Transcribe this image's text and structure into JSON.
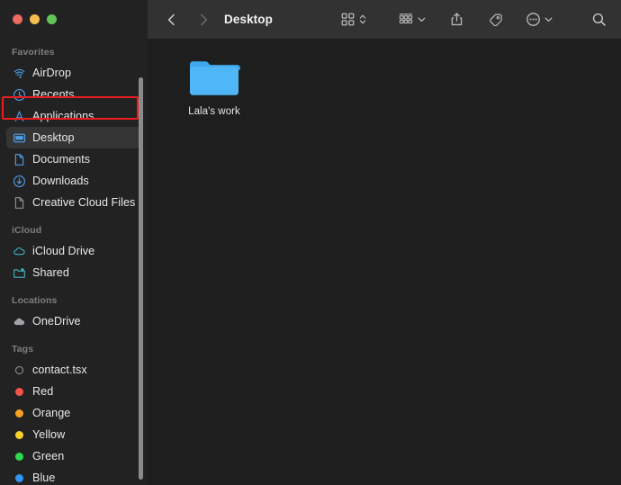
{
  "window": {
    "traffic_lights": [
      {
        "name": "close",
        "color": "#ec6a5f"
      },
      {
        "name": "minimize",
        "color": "#f4bd4f"
      },
      {
        "name": "maximize",
        "color": "#61c454"
      }
    ]
  },
  "toolbar": {
    "back_label": "‹",
    "forward_label": "›",
    "title": "Desktop",
    "buttons": [
      {
        "name": "icon-view-button",
        "icon": "grid-icon"
      },
      {
        "name": "group-by-button",
        "icon": "group-icon"
      },
      {
        "name": "share-button",
        "icon": "share-icon"
      },
      {
        "name": "tag-button",
        "icon": "tag-icon"
      },
      {
        "name": "more-actions-button",
        "icon": "ellipsis-icon"
      },
      {
        "name": "search-button",
        "icon": "search-icon"
      }
    ]
  },
  "sidebar": {
    "sections": [
      {
        "title": "Favorites",
        "items": [
          {
            "label": "AirDrop",
            "icon": "airdrop-icon",
            "selected": false
          },
          {
            "label": "Recents",
            "icon": "clock-icon",
            "selected": false
          },
          {
            "label": "Applications",
            "icon": "applications-icon",
            "selected": false,
            "highlighted": true
          },
          {
            "label": "Desktop",
            "icon": "desktop-icon",
            "selected": true
          },
          {
            "label": "Documents",
            "icon": "document-icon",
            "selected": false
          },
          {
            "label": "Downloads",
            "icon": "downloads-icon",
            "selected": false
          },
          {
            "label": "Creative Cloud Files",
            "icon": "document-icon",
            "selected": false
          }
        ]
      },
      {
        "title": "iCloud",
        "items": [
          {
            "label": "iCloud Drive",
            "icon": "cloud-icon",
            "selected": false
          },
          {
            "label": "Shared",
            "icon": "shared-folder-icon",
            "selected": false
          }
        ]
      },
      {
        "title": "Locations",
        "items": [
          {
            "label": "OneDrive",
            "icon": "cloud-gray-icon",
            "selected": false
          }
        ]
      },
      {
        "title": "Tags",
        "items": [
          {
            "label": "contact.tsx",
            "icon": "tag-dot-hollow",
            "color": "transparent",
            "selected": false
          },
          {
            "label": "Red",
            "icon": "tag-dot",
            "color": "#f8524b",
            "selected": false
          },
          {
            "label": "Orange",
            "icon": "tag-dot",
            "color": "#f6a124",
            "selected": false
          },
          {
            "label": "Yellow",
            "icon": "tag-dot",
            "color": "#f6d42b",
            "selected": false
          },
          {
            "label": "Green",
            "icon": "tag-dot",
            "color": "#2fd74f",
            "selected": false
          },
          {
            "label": "Blue",
            "icon": "tag-dot",
            "color": "#3296f5",
            "selected": false
          }
        ]
      }
    ]
  },
  "files": [
    {
      "name": "Lala's work",
      "type": "folder"
    }
  ],
  "colors": {
    "sidebar_bg": "#222222",
    "content_bg": "#1e1e1e",
    "toolbar_bg": "#323232",
    "selection": "#353535",
    "accent_blue": "#3b9cf0",
    "folder_blue": "#4fb4f5",
    "highlight_red": "#ee1c1c",
    "icloud_teal": "#3fb8c4"
  }
}
